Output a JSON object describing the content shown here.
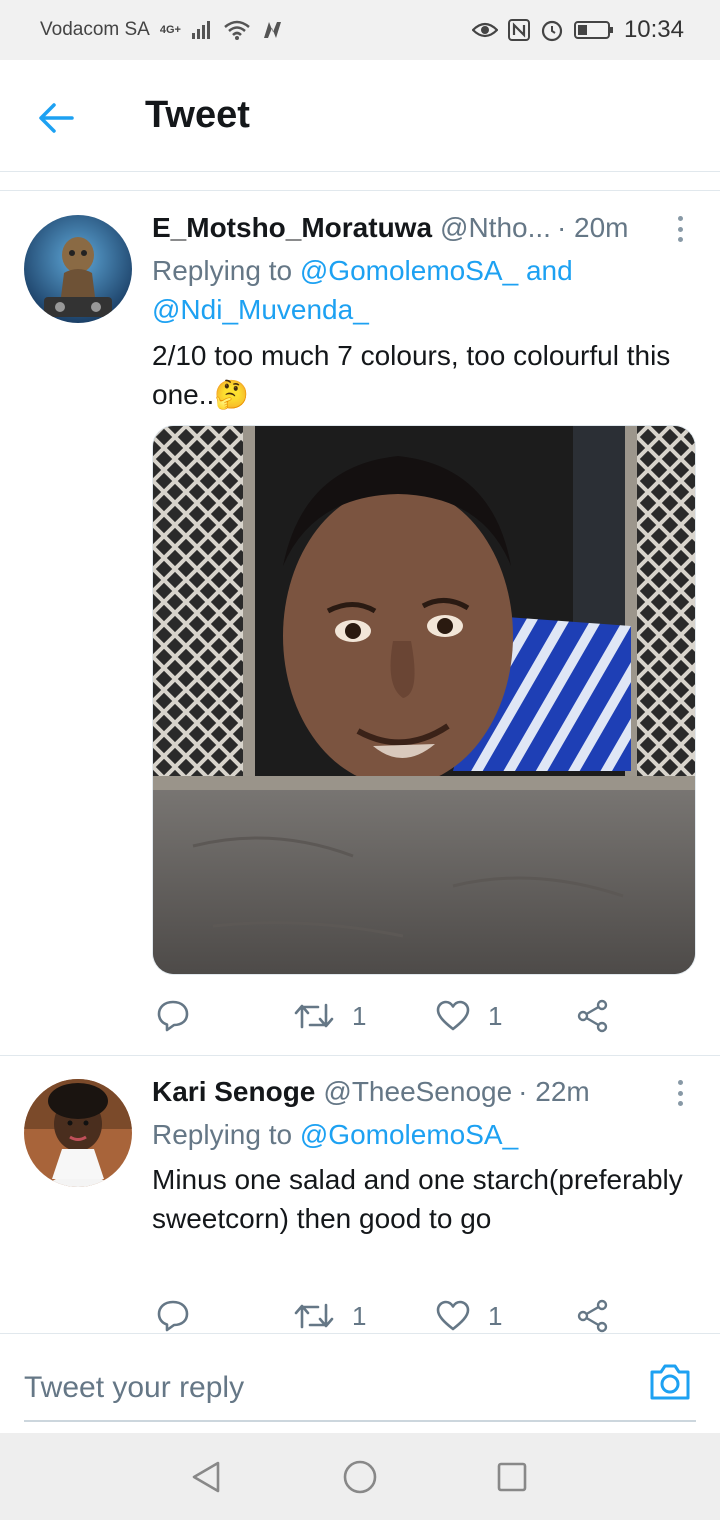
{
  "status_bar": {
    "carrier": "Vodacom SA",
    "network": "4G+",
    "time": "10:34"
  },
  "header": {
    "title": "Tweet"
  },
  "tweets": [
    {
      "name": "E_Motsho_Moratuwa",
      "handle": "@Ntho...",
      "time": "· 20m",
      "replying_prefix": "Replying to ",
      "mention_1": "@GomolemoSA_",
      "and": " and",
      "mention_2": "@Ndi_Muvenda_",
      "text": "2/10 too much 7 colours, too colourful this one..🤔",
      "retweets": "1",
      "likes": "1"
    },
    {
      "name": "Kari Senoge",
      "handle": "@TheeSenoge",
      "time": "· 22m",
      "replying_prefix": "Replying to ",
      "mention_1": "@GomolemoSA_",
      "text": "Minus one salad and one starch(preferably sweetcorn) then good to go",
      "retweets": "1",
      "likes": "1"
    }
  ],
  "reply": {
    "placeholder": "Tweet your reply"
  },
  "colors": {
    "accent": "#1da1f2",
    "secondary_text": "#657786",
    "divider": "#e1e8ed"
  }
}
